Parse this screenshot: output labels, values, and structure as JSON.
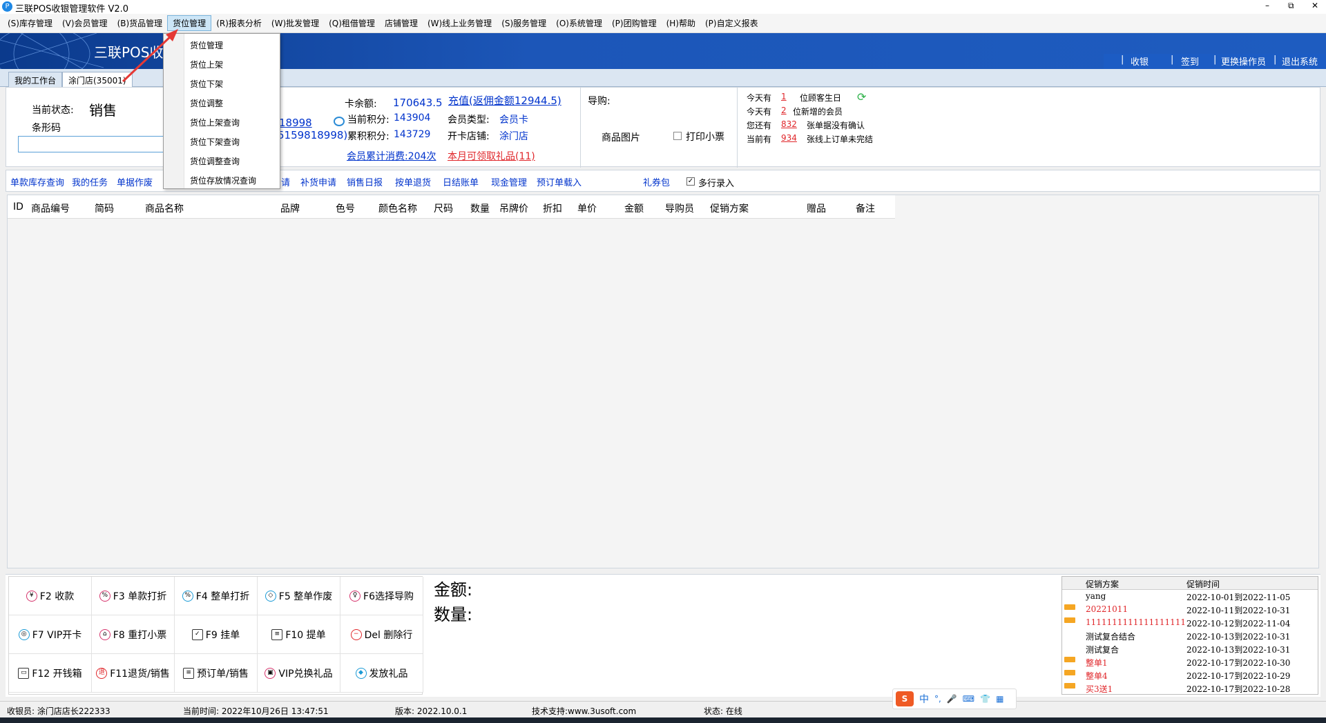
{
  "window": {
    "title": "三联POS收银管理软件 V2.0",
    "controls": [
      "–",
      "⧉",
      "✕"
    ]
  },
  "menubar": [
    "(S)库存管理",
    "(V)会员管理",
    "(B)货品管理",
    "货位管理",
    "(R)报表分析",
    "(W)批发管理",
    "(Q)租借管理",
    "店铺管理",
    "(W)线上业务管理",
    "(S)服务管理",
    "(O)系统管理",
    "(P)团购管理",
    "(H)帮助",
    "(P)自定义报表"
  ],
  "banner": {
    "logo_text": "三联POS收",
    "links": [
      "收银",
      "签到",
      "更换操作员",
      "退出系统"
    ]
  },
  "tabs": [
    "我的工作台",
    "涂门店(35001)"
  ],
  "dropdown": [
    "货位管理",
    "货位上架",
    "货位下架",
    "货位调整",
    "货位上架查询",
    "货位下架查询",
    "货位调整查询",
    "货位存放情况查询"
  ],
  "info": {
    "status_label": "当前状态:",
    "status_value": "销售",
    "barcode_label": "条形码",
    "member_id_1": "18998",
    "member_id_2": "5159818998)",
    "card_balance_label": "卡余额:",
    "card_balance": "170643.5",
    "recharge_link": "充值(返佣金额12944.5)",
    "current_points_label": "当前积分:",
    "current_points": "143904",
    "member_type_label": "会员类型:",
    "member_type": "会员卡",
    "total_points_label": "累积积分:",
    "total_points": "143729",
    "card_store_label": "开卡店铺:",
    "card_store": "涂门店",
    "consumption_link": "会员累计消费:204次",
    "gift_link": "本月可领取礼品(11)",
    "guide_label": "导购:",
    "product_image_label": "商品图片",
    "print_receipt_label": "打印小票"
  },
  "notices": [
    {
      "prefix": "今天有",
      "count": "1",
      "suffix": "位顾客生日"
    },
    {
      "prefix": "今天有",
      "count": "2",
      "suffix": "位新增的会员"
    },
    {
      "prefix": "您还有",
      "count": "832",
      "suffix": "张单据没有确认"
    },
    {
      "prefix": "当前有",
      "count": "934",
      "suffix": "张线上订单未完结"
    }
  ],
  "quicklinks": [
    "单款库存查询",
    "我的任务",
    "单据作废",
    "请",
    "补货申请",
    "销售日报",
    "按单退货",
    "日结账单",
    "现金管理",
    "预订单载入",
    "礼券包"
  ],
  "multi_entry_label": "多行录入",
  "columns": [
    "ID",
    "商品编号",
    "简码",
    "商品名称",
    "品牌",
    "色号",
    "颜色名称",
    "尺码",
    "数量",
    "吊牌价",
    "折扣",
    "单价",
    "金额",
    "导购员",
    "促销方案",
    "赠品",
    "备注"
  ],
  "fbuttons": [
    {
      "label": "F2 收款",
      "icon": "¥"
    },
    {
      "label": "F3 单款打折",
      "icon": "%"
    },
    {
      "label": "F4 整单打折",
      "icon": "%"
    },
    {
      "label": "F5 整单作废",
      "icon": "◇"
    },
    {
      "label": "F6选择导购",
      "icon": "♀"
    },
    {
      "label": "F7 VIP开卡",
      "icon": "◎"
    },
    {
      "label": "F8 重打小票",
      "icon": "⌂"
    },
    {
      "label": "F9 挂单",
      "icon": "✓"
    },
    {
      "label": "F10 提单",
      "icon": "≡"
    },
    {
      "label": "Del 删除行",
      "icon": "−"
    },
    {
      "label": "F12 开钱箱",
      "icon": "▭"
    },
    {
      "label": "F11退货/销售",
      "icon": "退"
    },
    {
      "label": "预订单/销售",
      "icon": "≡"
    },
    {
      "label": "VIP兑换礼品",
      "icon": "▣"
    },
    {
      "label": "发放礼品",
      "icon": "◆"
    }
  ],
  "summary": {
    "amount_label": "金额:",
    "qty_label": "数量:"
  },
  "promo": {
    "col1": "促销方案",
    "col2": "促销时间",
    "rows": [
      {
        "name": "yang",
        "period": "2022-10-01到2022-11-05",
        "new": false,
        "red": false
      },
      {
        "name": "20221011",
        "period": "2022-10-11到2022-10-31",
        "new": true,
        "red": true
      },
      {
        "name": "1111111111111111111",
        "period": "2022-10-12到2022-11-04",
        "new": true,
        "red": true
      },
      {
        "name": "测试复合结合",
        "period": "2022-10-13到2022-10-31",
        "new": false,
        "red": false
      },
      {
        "name": "测试复合",
        "period": "2022-10-13到2022-10-31",
        "new": false,
        "red": false
      },
      {
        "name": "整单1",
        "period": "2022-10-17到2022-10-30",
        "new": true,
        "red": true
      },
      {
        "name": "整单4",
        "period": "2022-10-17到2022-10-29",
        "new": true,
        "red": true
      },
      {
        "name": "买3送1",
        "period": "2022-10-17到2022-10-28",
        "new": true,
        "red": true
      }
    ]
  },
  "statusbar": {
    "cashier": "收银员: 涂门店店长222333",
    "time": "当前时间: 2022年10月26日 13:47:51",
    "version": "版本: 2022.10.0.1",
    "support": "技术支持:www.3usoft.com",
    "state": "状态: 在线"
  },
  "ime": {
    "logo": "S",
    "chars": [
      "中",
      "°,",
      "🎤",
      "⌨",
      "👕",
      "▦"
    ]
  },
  "colors": {
    "accent": "#0033cc",
    "alert": "#e0262a",
    "banner": "#1c56b8"
  }
}
